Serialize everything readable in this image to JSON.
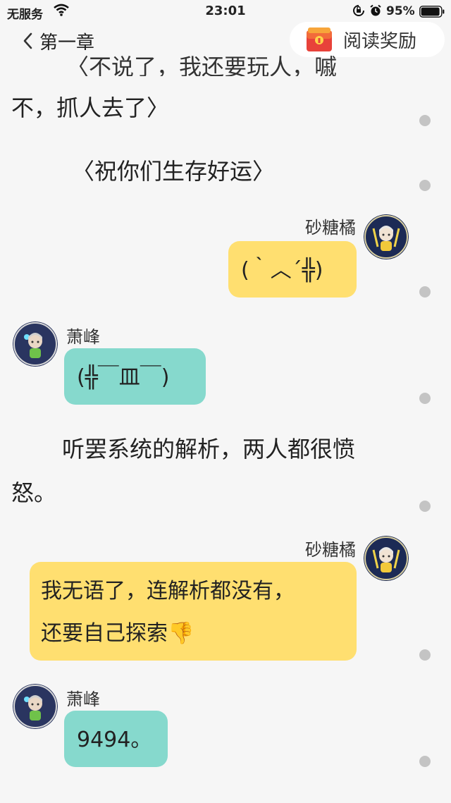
{
  "status_bar": {
    "carrier": "无服务",
    "time": "23:01",
    "battery": "95%",
    "battery_level": 0.95
  },
  "nav": {
    "back_label": "第一章",
    "reward_label": "阅读奖励"
  },
  "content": {
    "partial_top": "〈不说了，我还要玩人，嘁",
    "p1_line2": "不，抓人去了〉",
    "p2": "〈祝你们生存好运〉",
    "msg1": {
      "name": "砂糖橘",
      "text": "(｀︿´╬)"
    },
    "msg2": {
      "name": "萧峰",
      "text": "(╬￣皿￣)"
    },
    "p3_line1": "听罢系统的解析，两人都很愤",
    "p3_line2": "怒。",
    "msg3": {
      "name": "砂糖橘",
      "line1": "我无语了，连解析都没有，",
      "line2": "还要自己探索👎"
    },
    "msg4": {
      "name": "萧峰",
      "text": "9494。"
    }
  },
  "colors": {
    "background": "#f6f6f6",
    "bubble_yellow": "#ffdf70",
    "bubble_teal": "#86d9cd",
    "comment_dot": "#c4c4c4"
  },
  "icons": [
    "wifi-icon",
    "rotation-lock-icon",
    "alarm-icon",
    "battery-icon",
    "back-chevron-icon",
    "red-packet-icon",
    "comment-dot-icon"
  ]
}
